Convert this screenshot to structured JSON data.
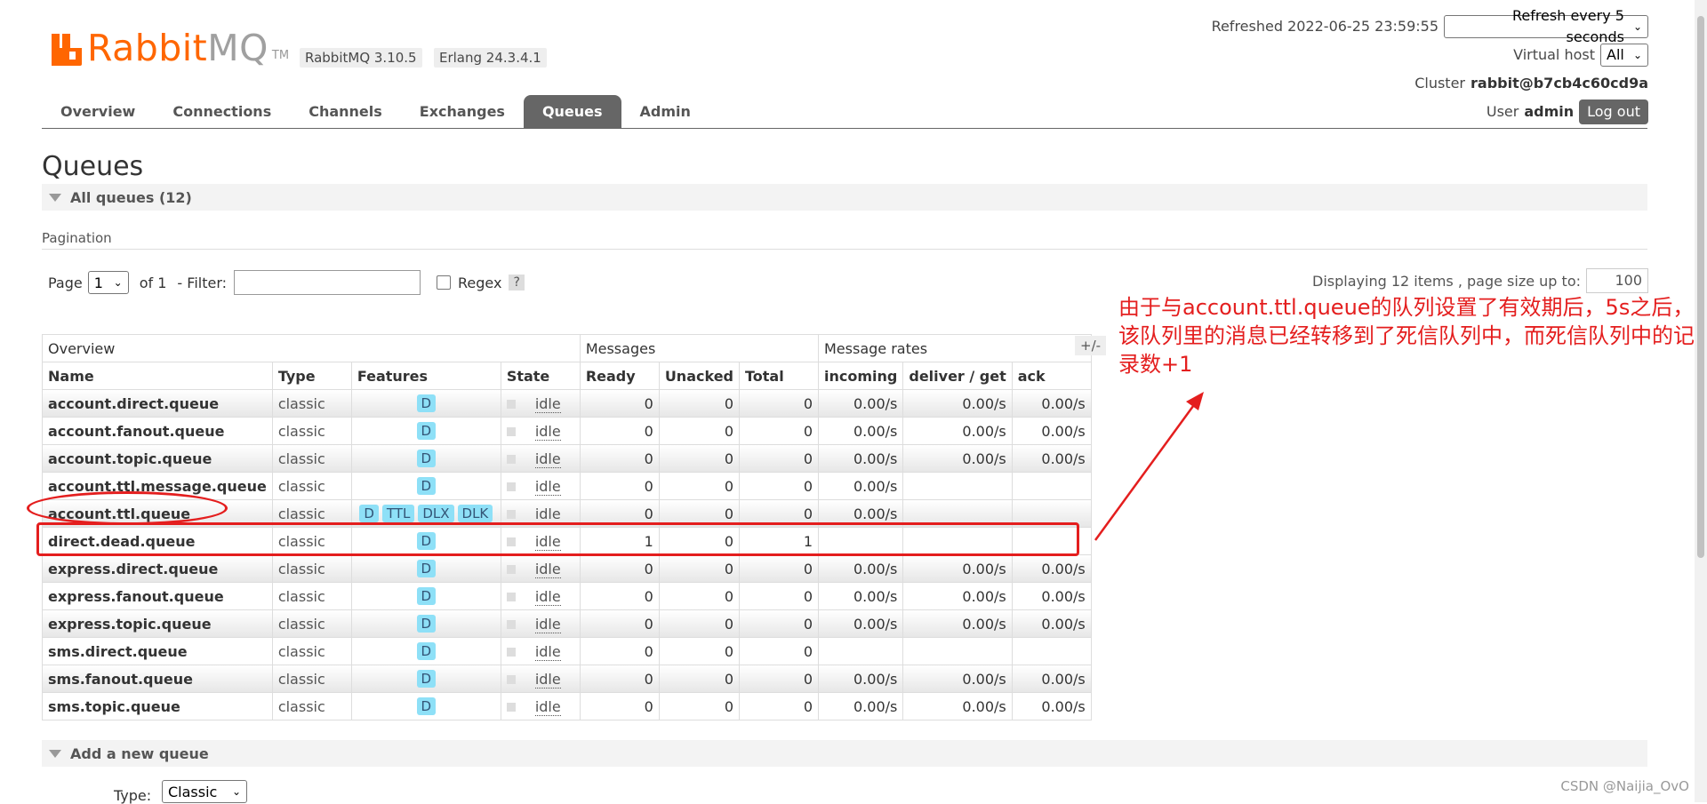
{
  "app": {
    "logo_main": "Rabbit",
    "logo_accent": "MQ",
    "logo_tm": "TM",
    "version": "RabbitMQ 3.10.5",
    "erlang": "Erlang 24.3.4.1"
  },
  "header": {
    "refreshed": "Refreshed 2022-06-25 23:59:55",
    "refresh_option": "Refresh every 5 seconds",
    "vhost_label": "Virtual host",
    "vhost_value": "All",
    "cluster_label": "Cluster",
    "cluster_value": "rabbit@b7cb4c60cd9a",
    "user_label": "User",
    "user_value": "admin",
    "logout": "Log out"
  },
  "nav": {
    "tabs": [
      {
        "label": "Overview"
      },
      {
        "label": "Connections"
      },
      {
        "label": "Channels"
      },
      {
        "label": "Exchanges"
      },
      {
        "label": "Queues"
      },
      {
        "label": "Admin"
      }
    ]
  },
  "page": {
    "title": "Queues",
    "all_queues": "All queues (12)",
    "pagination": "Pagination",
    "page_label": "Page",
    "page_value": "1",
    "of_label": "of 1",
    "filter_label": "- Filter:",
    "regex_label": "Regex",
    "help": "?",
    "displaying": "Displaying 12 items , page size up to:",
    "page_size": "100",
    "plus_minus": "+/-",
    "add_queue": "Add a new queue",
    "type_label": "Type:",
    "type_value": "Classic"
  },
  "table": {
    "groups": [
      "Overview",
      "Messages",
      "Message rates"
    ],
    "headers": [
      "Name",
      "Type",
      "Features",
      "State",
      "Ready",
      "Unacked",
      "Total",
      "incoming",
      "deliver / get",
      "ack"
    ],
    "rows": [
      {
        "name": "account.direct.queue",
        "type": "classic",
        "features": [
          "D"
        ],
        "state": "idle",
        "ready": "0",
        "unacked": "0",
        "total": "0",
        "incoming": "0.00/s",
        "deliver": "0.00/s",
        "ack": "0.00/s"
      },
      {
        "name": "account.fanout.queue",
        "type": "classic",
        "features": [
          "D"
        ],
        "state": "idle",
        "ready": "0",
        "unacked": "0",
        "total": "0",
        "incoming": "0.00/s",
        "deliver": "0.00/s",
        "ack": "0.00/s"
      },
      {
        "name": "account.topic.queue",
        "type": "classic",
        "features": [
          "D"
        ],
        "state": "idle",
        "ready": "0",
        "unacked": "0",
        "total": "0",
        "incoming": "0.00/s",
        "deliver": "0.00/s",
        "ack": "0.00/s"
      },
      {
        "name": "account.ttl.message.queue",
        "type": "classic",
        "features": [
          "D"
        ],
        "state": "idle",
        "ready": "0",
        "unacked": "0",
        "total": "0",
        "incoming": "0.00/s",
        "deliver": "",
        "ack": ""
      },
      {
        "name": "account.ttl.queue",
        "type": "classic",
        "features": [
          "D",
          "TTL",
          "DLX",
          "DLK"
        ],
        "state": "idle",
        "ready": "0",
        "unacked": "0",
        "total": "0",
        "incoming": "0.00/s",
        "deliver": "",
        "ack": ""
      },
      {
        "name": "direct.dead.queue",
        "type": "classic",
        "features": [
          "D"
        ],
        "state": "idle",
        "ready": "1",
        "unacked": "0",
        "total": "1",
        "incoming": "",
        "deliver": "",
        "ack": ""
      },
      {
        "name": "express.direct.queue",
        "type": "classic",
        "features": [
          "D"
        ],
        "state": "idle",
        "ready": "0",
        "unacked": "0",
        "total": "0",
        "incoming": "0.00/s",
        "deliver": "0.00/s",
        "ack": "0.00/s"
      },
      {
        "name": "express.fanout.queue",
        "type": "classic",
        "features": [
          "D"
        ],
        "state": "idle",
        "ready": "0",
        "unacked": "0",
        "total": "0",
        "incoming": "0.00/s",
        "deliver": "0.00/s",
        "ack": "0.00/s"
      },
      {
        "name": "express.topic.queue",
        "type": "classic",
        "features": [
          "D"
        ],
        "state": "idle",
        "ready": "0",
        "unacked": "0",
        "total": "0",
        "incoming": "0.00/s",
        "deliver": "0.00/s",
        "ack": "0.00/s"
      },
      {
        "name": "sms.direct.queue",
        "type": "classic",
        "features": [
          "D"
        ],
        "state": "idle",
        "ready": "0",
        "unacked": "0",
        "total": "0",
        "incoming": "",
        "deliver": "",
        "ack": ""
      },
      {
        "name": "sms.fanout.queue",
        "type": "classic",
        "features": [
          "D"
        ],
        "state": "idle",
        "ready": "0",
        "unacked": "0",
        "total": "0",
        "incoming": "0.00/s",
        "deliver": "0.00/s",
        "ack": "0.00/s"
      },
      {
        "name": "sms.topic.queue",
        "type": "classic",
        "features": [
          "D"
        ],
        "state": "idle",
        "ready": "0",
        "unacked": "0",
        "total": "0",
        "incoming": "0.00/s",
        "deliver": "0.00/s",
        "ack": "0.00/s"
      }
    ]
  },
  "annotation": {
    "text": "由于与account.ttl.queue的队列设置了有效期后，5s之后，该队列里的消息已经转移到了死信队列中，而死信队列中的记录数+1",
    "color": "#e41e1e"
  },
  "watermark": "CSDN @Naijia_OvO",
  "colors": {
    "brand": "#ff6600",
    "tab_active": "#666666",
    "feature_badge": "#8ee0f7"
  }
}
